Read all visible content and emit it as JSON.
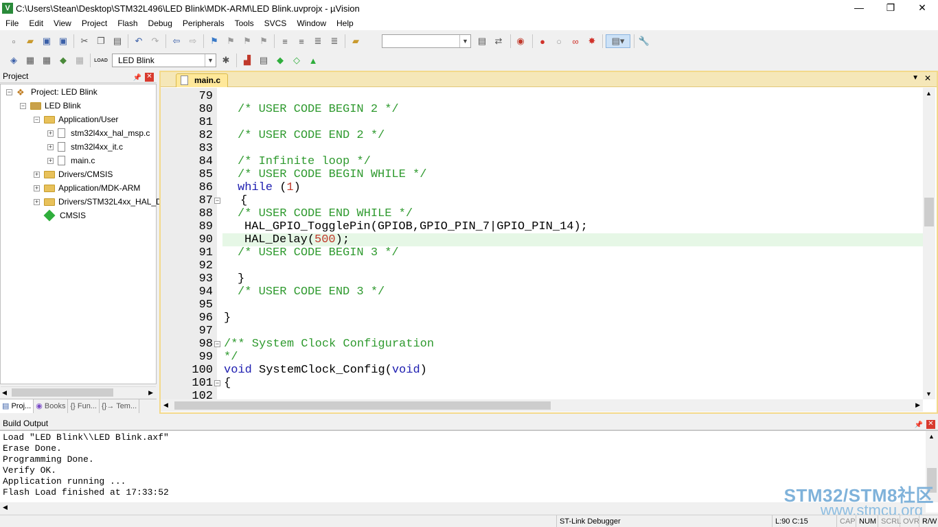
{
  "window": {
    "title": "C:\\Users\\Stean\\Desktop\\STM32L496\\LED Blink\\MDK-ARM\\LED Blink.uvprojx - µVision",
    "minimize": "—",
    "maximize": "❐",
    "close": "✕"
  },
  "menu": [
    "File",
    "Edit",
    "View",
    "Project",
    "Flash",
    "Debug",
    "Peripherals",
    "Tools",
    "SVCS",
    "Window",
    "Help"
  ],
  "toolbar": {
    "target": "LED Blink",
    "load_label": "LOAD"
  },
  "project_panel": {
    "title": "Project",
    "tree": [
      {
        "label": "Project: LED Blink"
      },
      {
        "label": "LED Blink"
      },
      {
        "label": "Application/User"
      },
      {
        "label": "stm32l4xx_hal_msp.c"
      },
      {
        "label": "stm32l4xx_it.c"
      },
      {
        "label": "main.c"
      },
      {
        "label": "Drivers/CMSIS"
      },
      {
        "label": "Application/MDK-ARM"
      },
      {
        "label": "Drivers/STM32L4xx_HAL_D"
      },
      {
        "label": "CMSIS"
      }
    ],
    "tabs": [
      "Proj...",
      "Books",
      "{} Fun...",
      "{}→ Tem..."
    ]
  },
  "editor": {
    "tab": "main.c",
    "line_numbers": [
      "79",
      "80",
      "81",
      "82",
      "83",
      "84",
      "85",
      "86",
      "87",
      "88",
      "89",
      "90",
      "91",
      "92",
      "93",
      "94",
      "95",
      "96",
      "97",
      "98",
      "99",
      "100",
      "101",
      "102"
    ],
    "lines": {
      "l80": "/* USER CODE BEGIN 2 */",
      "l82": "/* USER CODE END 2 */",
      "l84": "/* Infinite loop */",
      "l85": "/* USER CODE BEGIN WHILE */",
      "l86_kw": "while",
      "l86_rest": " (",
      "l86_num": "1",
      "l86_end": ")",
      "l87": "{",
      "l88": "/* USER CODE END WHILE */",
      "l89": "HAL_GPIO_TogglePin(GPIOB,GPIO_PIN_7|GPIO_PIN_14);",
      "l90_a": "HAL_Delay(",
      "l90_num": "500",
      "l90_b": ");",
      "l91": "/* USER CODE BEGIN 3 */",
      "l93": "}",
      "l94": "/* USER CODE END 3 */",
      "l96": "}",
      "l98": "/** System Clock Configuration",
      "l99": "*/",
      "l100_kw": "void",
      "l100_mid": " SystemClock_Config(",
      "l100_kw2": "void",
      "l100_end": ")",
      "l101": "{"
    }
  },
  "build_output": {
    "title": "Build Output",
    "lines": [
      "Load \"LED Blink\\\\LED Blink.axf\"",
      "Erase Done.",
      "Programming Done.",
      "Verify OK.",
      "Application running ...",
      "Flash Load finished at 17:33:52"
    ]
  },
  "status": {
    "debugger": "ST-Link Debugger",
    "position": "L:90 C:15",
    "cap": "CAP",
    "num": "NUM",
    "scrl": "SCRL",
    "ovr": "OVR",
    "rw": "R/W"
  },
  "watermark": {
    "line1": "STM32/STM8社区",
    "line2": "www.stmcu.org"
  }
}
